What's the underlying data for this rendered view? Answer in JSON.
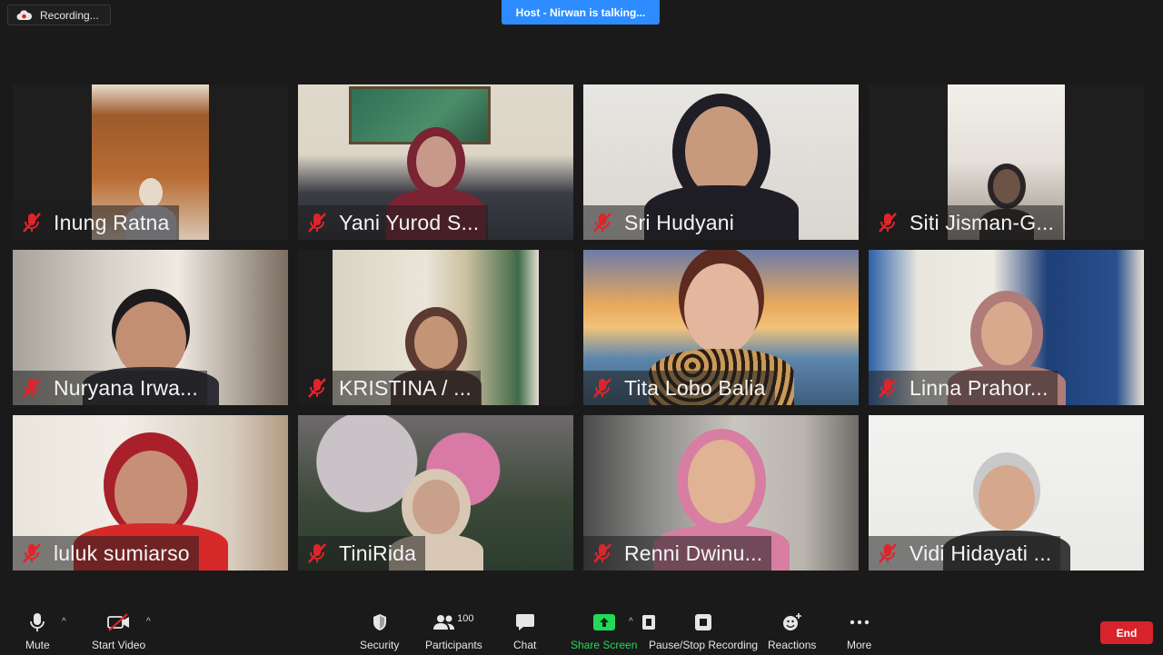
{
  "recording": {
    "label": "Recording..."
  },
  "banner": {
    "text": "Host - Nirwan is talking..."
  },
  "participants": [
    {
      "name": "Inung Ratna"
    },
    {
      "name": "Yani Yurod S..."
    },
    {
      "name": "Sri Hudyani"
    },
    {
      "name": "Siti Jisman-G..."
    },
    {
      "name": "Nuryana Irwa..."
    },
    {
      "name": "KRISTINA  / ..."
    },
    {
      "name": "Tita Lobo Balia"
    },
    {
      "name": "Linna Prahor..."
    },
    {
      "name": "luluk sumiarso"
    },
    {
      "name": "TiniRida"
    },
    {
      "name": "Renni Dwinu..."
    },
    {
      "name": "Vidi Hidayati ..."
    }
  ],
  "toolbar": {
    "mute": "Mute",
    "start_video": "Start Video",
    "security": "Security",
    "participants": "Participants",
    "participants_count": "100",
    "chat": "Chat",
    "share_screen": "Share Screen",
    "pause_stop_recording": "Pause/Stop Recording",
    "reactions": "Reactions",
    "more": "More",
    "end": "End"
  },
  "colors": {
    "banner": "#2d8cff",
    "end": "#d9232a",
    "share": "#23d959",
    "muted": "#e0242b"
  }
}
